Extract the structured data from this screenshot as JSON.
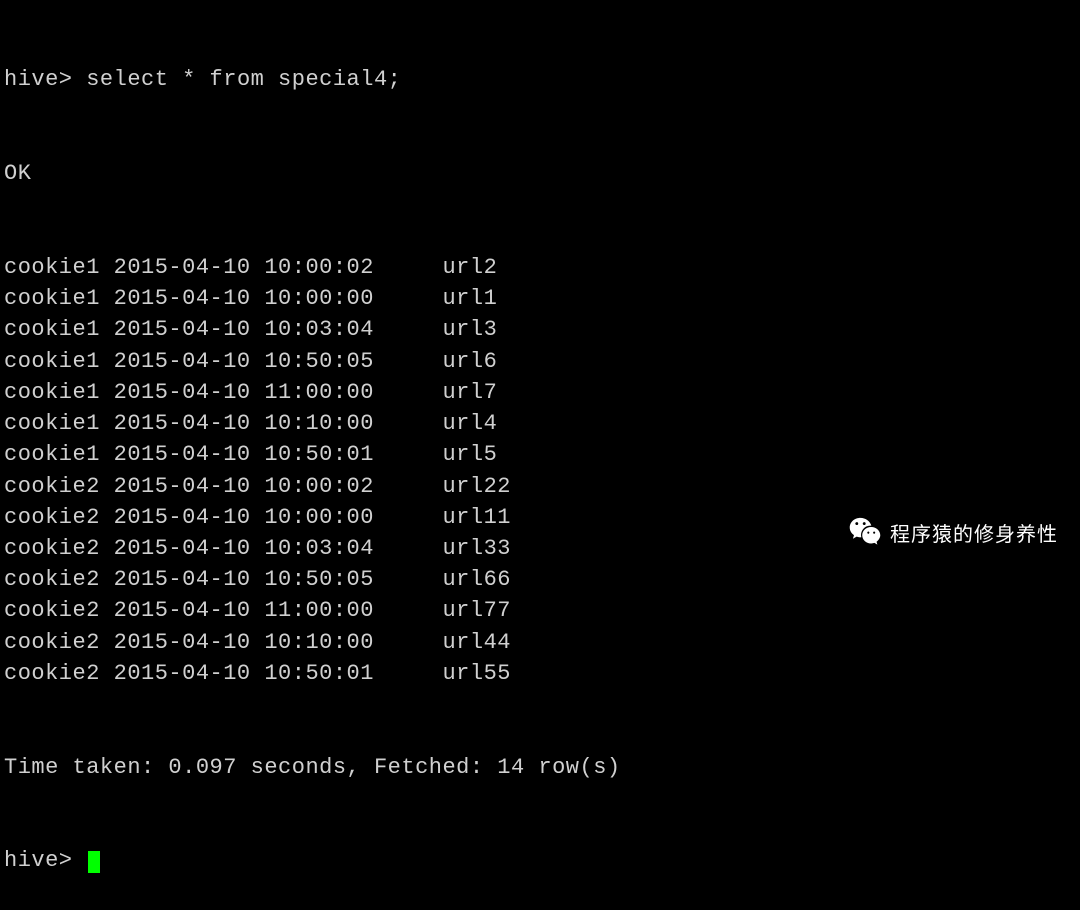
{
  "terminal": {
    "prompt": "hive>",
    "query": "select * from special4;",
    "status": "OK",
    "rows": [
      {
        "c1": "cookie1",
        "c2": "2015-04-10 10:00:02",
        "c3": "url2"
      },
      {
        "c1": "cookie1",
        "c2": "2015-04-10 10:00:00",
        "c3": "url1"
      },
      {
        "c1": "cookie1",
        "c2": "2015-04-10 10:03:04",
        "c3": "url3"
      },
      {
        "c1": "cookie1",
        "c2": "2015-04-10 10:50:05",
        "c3": "url6"
      },
      {
        "c1": "cookie1",
        "c2": "2015-04-10 11:00:00",
        "c3": "url7"
      },
      {
        "c1": "cookie1",
        "c2": "2015-04-10 10:10:00",
        "c3": "url4"
      },
      {
        "c1": "cookie1",
        "c2": "2015-04-10 10:50:01",
        "c3": "url5"
      },
      {
        "c1": "cookie2",
        "c2": "2015-04-10 10:00:02",
        "c3": "url22"
      },
      {
        "c1": "cookie2",
        "c2": "2015-04-10 10:00:00",
        "c3": "url11"
      },
      {
        "c1": "cookie2",
        "c2": "2015-04-10 10:03:04",
        "c3": "url33"
      },
      {
        "c1": "cookie2",
        "c2": "2015-04-10 10:50:05",
        "c3": "url66"
      },
      {
        "c1": "cookie2",
        "c2": "2015-04-10 11:00:00",
        "c3": "url77"
      },
      {
        "c1": "cookie2",
        "c2": "2015-04-10 10:10:00",
        "c3": "url44"
      },
      {
        "c1": "cookie2",
        "c2": "2015-04-10 10:50:01",
        "c3": "url55"
      }
    ],
    "summary": "Time taken: 0.097 seconds, Fetched: 14 row(s)",
    "next_prompt": "hive>"
  },
  "watermark": {
    "text": "程序猿的修身养性"
  }
}
